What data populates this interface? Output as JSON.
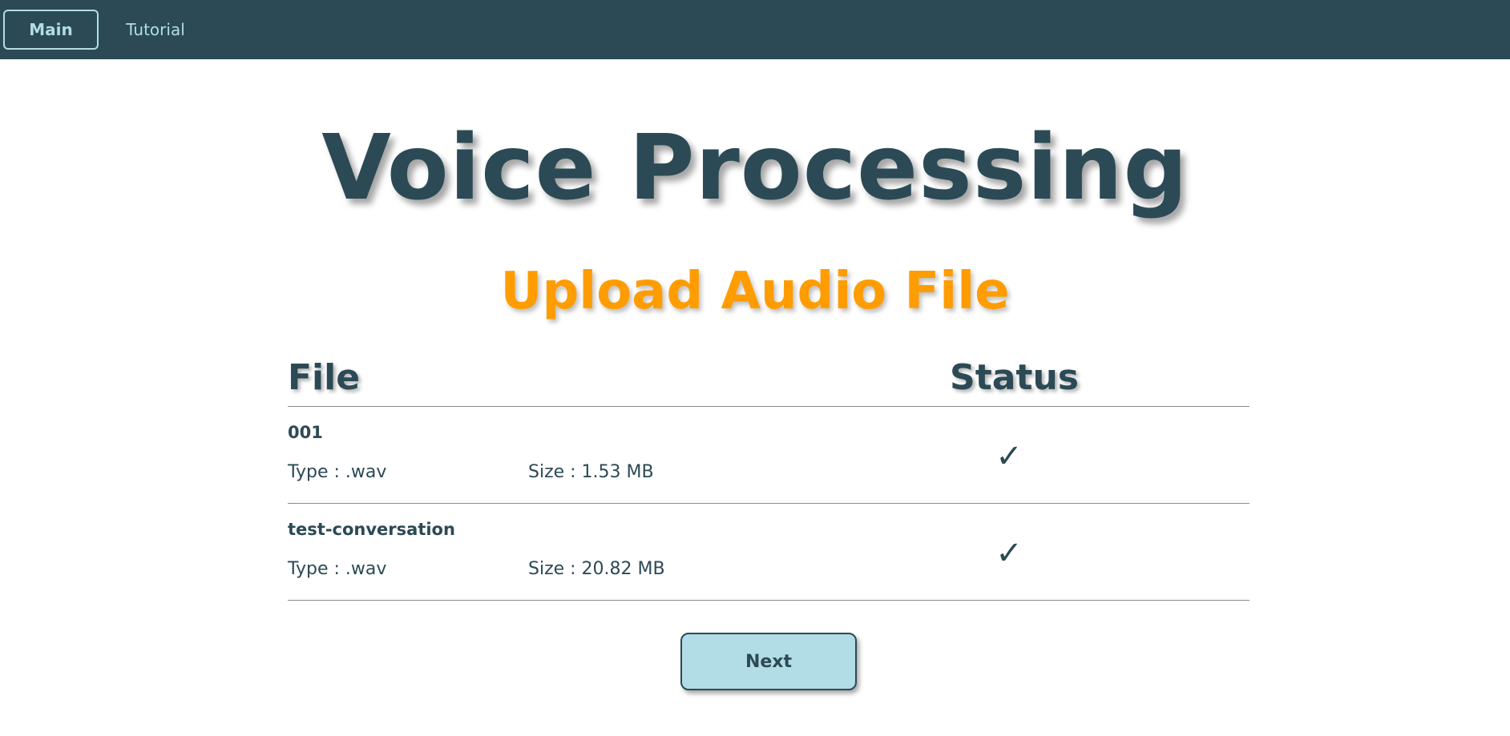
{
  "nav": {
    "items": [
      {
        "label": "Main",
        "active": true
      },
      {
        "label": "Tutorial",
        "active": false
      }
    ]
  },
  "header": {
    "title": "Voice Processing",
    "subtitle": "Upload Audio File"
  },
  "table": {
    "columns": [
      "File",
      "Status"
    ],
    "rows": [
      {
        "name": "001",
        "type": "Type : .wav",
        "size": "Size : 1.53 MB",
        "status": "✓"
      },
      {
        "name": "test-conversation",
        "type": "Type : .wav",
        "size": "Size : 20.82 MB",
        "status": "✓"
      }
    ]
  },
  "actions": {
    "next_label": "Next"
  },
  "colors": {
    "primary": "#2c4a55",
    "accent": "#ff9c00",
    "button_bg": "#b3dde6"
  }
}
